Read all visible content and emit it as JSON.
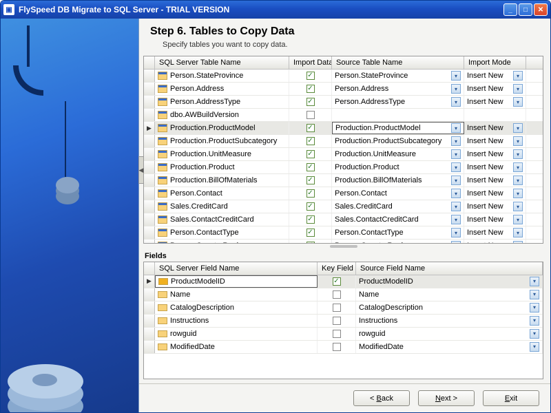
{
  "window": {
    "title": "FlySpeed DB Migrate to SQL Server - TRIAL VERSION"
  },
  "step": {
    "title": "Step 6. Tables to Copy Data",
    "subtitle": "Specify tables you want to copy data."
  },
  "tables": {
    "columns": [
      "SQL Server Table Name",
      "Import Data",
      "Source Table Name",
      "Import Mode"
    ],
    "import_mode_label": "Insert New",
    "rows": [
      {
        "name": "Person.StateProvince",
        "import": true,
        "source": "Person.StateProvince"
      },
      {
        "name": "Person.Address",
        "import": true,
        "source": "Person.Address"
      },
      {
        "name": "Person.AddressType",
        "import": true,
        "source": "Person.AddressType"
      },
      {
        "name": "dbo.AWBuildVersion",
        "import": false,
        "source": ""
      },
      {
        "name": "Production.ProductModel",
        "import": true,
        "source": "Production.ProductModel",
        "selected": true
      },
      {
        "name": "Production.ProductSubcategory",
        "import": true,
        "source": "Production.ProductSubcategory"
      },
      {
        "name": "Production.UnitMeasure",
        "import": true,
        "source": "Production.UnitMeasure"
      },
      {
        "name": "Production.Product",
        "import": true,
        "source": "Production.Product"
      },
      {
        "name": "Production.BillOfMaterials",
        "import": true,
        "source": "Production.BillOfMaterials"
      },
      {
        "name": "Person.Contact",
        "import": true,
        "source": "Person.Contact"
      },
      {
        "name": "Sales.CreditCard",
        "import": true,
        "source": "Sales.CreditCard"
      },
      {
        "name": "Sales.ContactCreditCard",
        "import": true,
        "source": "Sales.ContactCreditCard"
      },
      {
        "name": "Person.ContactType",
        "import": true,
        "source": "Person.ContactType"
      },
      {
        "name": "Person.CountryRegion",
        "import": true,
        "source": "Person.CountryRegion"
      }
    ]
  },
  "fields": {
    "label": "Fields",
    "columns": [
      "SQL Server Field Name",
      "Key Field",
      "Source Field Name"
    ],
    "rows": [
      {
        "name": "ProductModelID",
        "key": true,
        "source": "ProductModelID",
        "selected": true
      },
      {
        "name": "Name",
        "key": false,
        "source": "Name"
      },
      {
        "name": "CatalogDescription",
        "key": false,
        "source": "CatalogDescription"
      },
      {
        "name": "Instructions",
        "key": false,
        "source": "Instructions"
      },
      {
        "name": "rowguid",
        "key": false,
        "source": "rowguid"
      },
      {
        "name": "ModifiedDate",
        "key": false,
        "source": "ModifiedDate"
      }
    ]
  },
  "buttons": {
    "back": "Back",
    "next": "Next",
    "exit": "Exit"
  }
}
